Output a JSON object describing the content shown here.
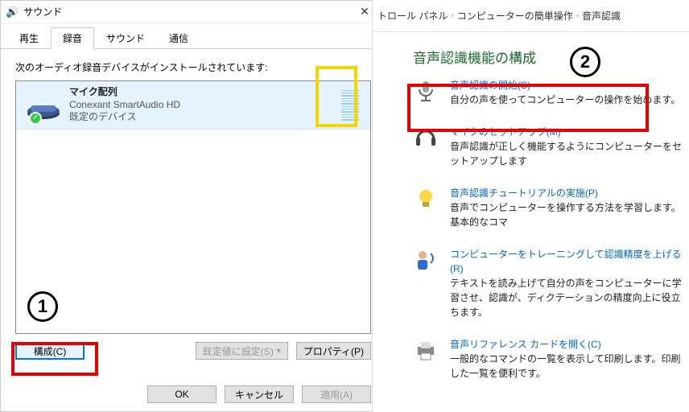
{
  "dialog": {
    "title": "サウンド",
    "tabs": {
      "playback": "再生",
      "recording": "録音",
      "sounds": "サウンド",
      "communications": "通信"
    },
    "instruction": "次のオーディオ録音デバイスがインストールされています:",
    "device": {
      "name": "マイク配列",
      "subtitle": "Conexant SmartAudio HD",
      "default": "既定のデバイス"
    },
    "buttons": {
      "configure": "構成(C)",
      "set_default": "既定値に設定(S)",
      "properties": "プロパティ(P)",
      "ok": "OK",
      "cancel": "キャンセル",
      "apply": "適用(A)"
    }
  },
  "annotations": {
    "one": "1",
    "two": "2"
  },
  "panel": {
    "breadcrumb": {
      "control_panel": "トロール パネル",
      "ease_of_access": "コンピューターの簡単操作",
      "speech": "音声認識"
    },
    "heading": "音声認識機能の構成",
    "options": {
      "start": {
        "link": "音声認識の開始(S)",
        "desc": "自分の声を使ってコンピューターの操作を始めます。"
      },
      "setup_mic": {
        "link": "マイクのセットアップ(M)",
        "desc": "音声認識が正しく機能するようにコンピューターをセットアップします"
      },
      "tutorial": {
        "link": "音声認識チュートリアルの実施(P)",
        "desc": "音声でコンピューターを操作する方法を学習します。基本的なコマ"
      },
      "train": {
        "link": "コンピューターをトレーニングして認識精度を上げる(R)",
        "desc": "テキストを読み上げて自分の声をコンピューターに学習させ、認識が、ディクテーションの精度向上に役立ちます。"
      },
      "reference": {
        "link": "音声リファレンス カードを開く(C)",
        "desc": "一般的なコマンドの一覧を表示して印刷します。印刷した一覧を便利です。"
      }
    }
  }
}
